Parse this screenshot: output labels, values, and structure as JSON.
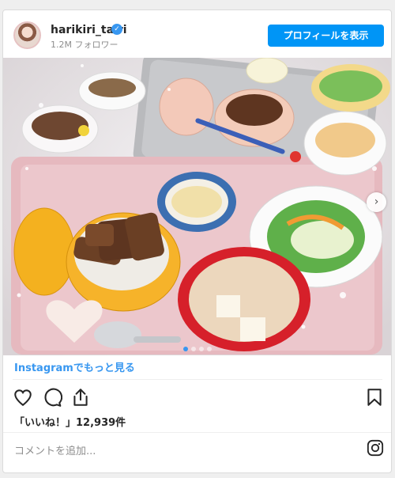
{
  "post": {
    "username": "harikiri_tairi",
    "verified_icon": "verified-check-icon",
    "followers": "1.2M フォロワー",
    "follow_button": "プロフィールを表示",
    "more_link": "Instagramでもっと見る",
    "likes": "「いいね！」12,939件",
    "comment_placeholder": "コメントを追加...",
    "image_alt": "Two trays of meals: stewed pork over rice, bean sprouts, miso soup with tofu, green salad with dressing",
    "carousel": {
      "index": 1,
      "total": 4
    },
    "icons": [
      "heart-icon",
      "comment-icon",
      "share-icon",
      "bookmark-icon",
      "instagram-icon",
      "chevron-right-icon"
    ]
  },
  "colors": {
    "accent": "#0095f6",
    "link": "#3897f0",
    "bg": "#efefef"
  }
}
